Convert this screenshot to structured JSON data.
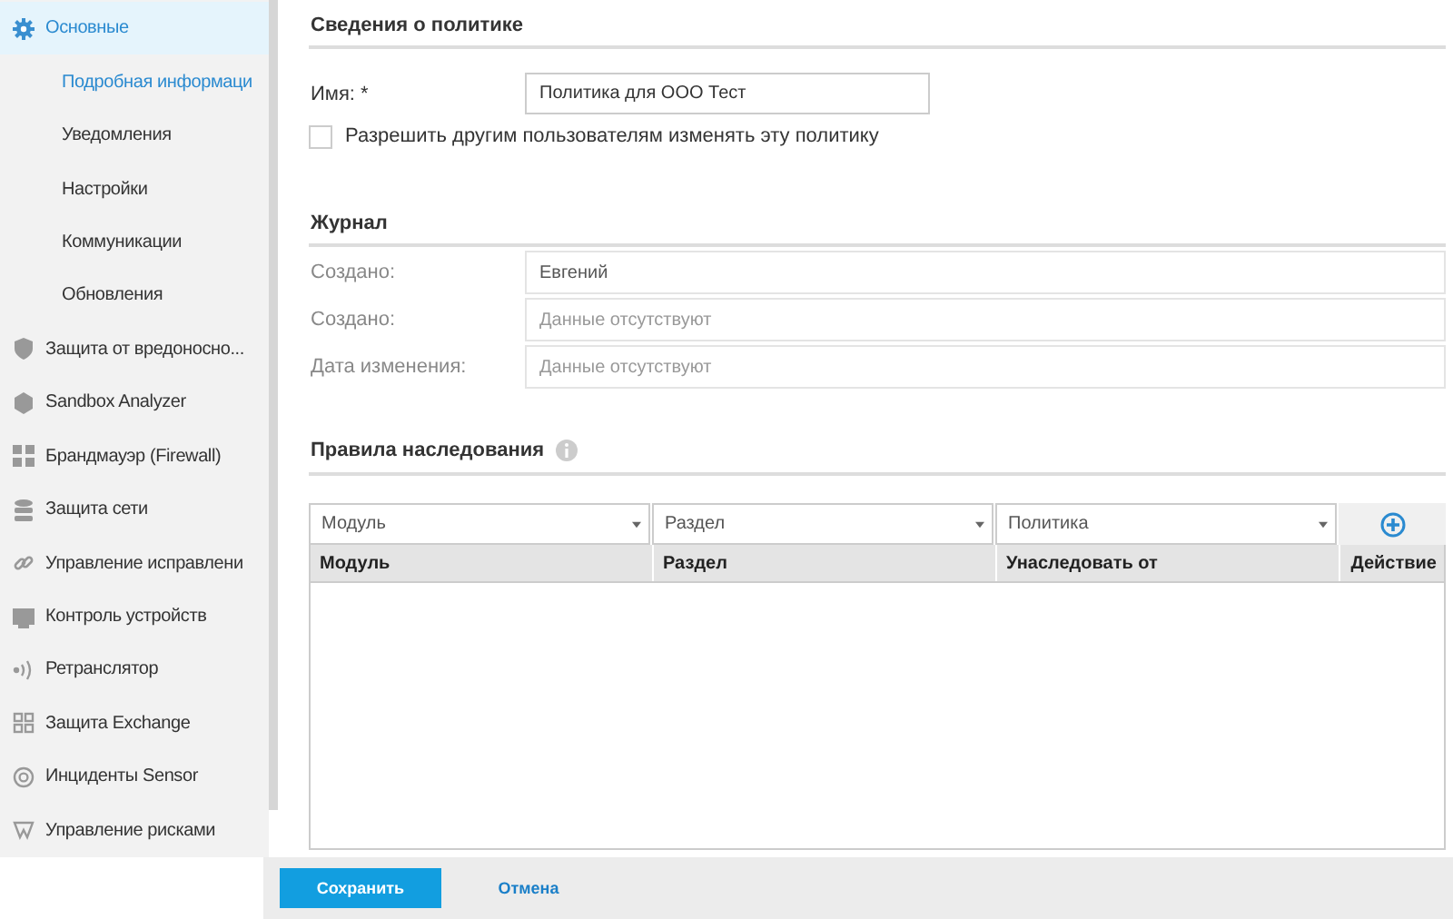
{
  "sidebar": {
    "items": [
      {
        "label": "Основные",
        "selected": true,
        "children": [
          {
            "label": "Подробная информаци",
            "selected": true
          },
          {
            "label": "Уведомления",
            "selected": false
          },
          {
            "label": "Настройки",
            "selected": false
          },
          {
            "label": "Коммуникации",
            "selected": false
          },
          {
            "label": "Обновления",
            "selected": false
          }
        ]
      },
      {
        "label": "Защита от вредоносно...",
        "selected": false
      },
      {
        "label": "Sandbox Analyzer",
        "selected": false
      },
      {
        "label": "Брандмауэр (Firewall)",
        "selected": false
      },
      {
        "label": "Защита сети",
        "selected": false
      },
      {
        "label": "Управление исправлени",
        "selected": false
      },
      {
        "label": "Контроль устройств",
        "selected": false
      },
      {
        "label": "Ретранслятор",
        "selected": false
      },
      {
        "label": "Защита Exchange",
        "selected": false
      },
      {
        "label": "Инциденты Sensor",
        "selected": false
      },
      {
        "label": "Управление рисками",
        "selected": false
      }
    ]
  },
  "policy_info": {
    "title": "Сведения о политике",
    "name_label": "Имя: *",
    "name_value": "Политика для ООО Тест",
    "allow_edit": {
      "label": "Разрешить другим пользователям изменять эту политику",
      "checked": false
    }
  },
  "journal": {
    "title": "Журнал",
    "rows": [
      {
        "label": "Создано:",
        "value": "Евгений"
      },
      {
        "label": "Создано:",
        "placeholder": "Данные отсутствуют"
      },
      {
        "label": "Дата изменения:",
        "placeholder": "Данные отсутствуют"
      }
    ]
  },
  "inheritance": {
    "title": "Правила наследования",
    "filters": [
      "Модуль",
      "Раздел",
      "Политика"
    ],
    "table": {
      "columns": [
        "Модуль",
        "Раздел",
        "Унаследовать от",
        "Действие"
      ]
    }
  },
  "footer": {
    "buttons": [
      {
        "label": "Сохранить",
        "kind": "primary"
      },
      {
        "label": "Отмена",
        "kind": "link"
      }
    ]
  }
}
